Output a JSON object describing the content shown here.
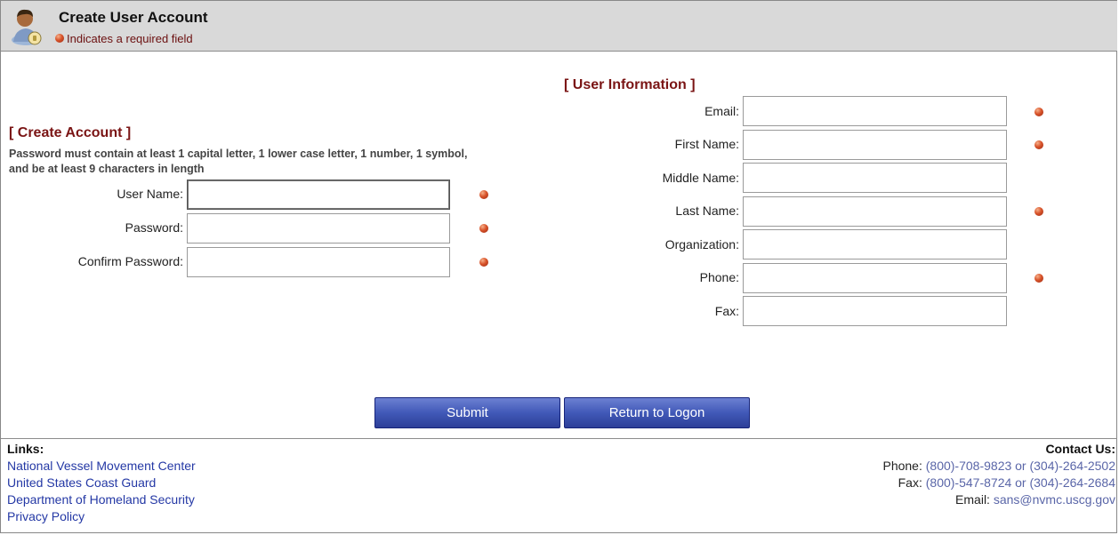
{
  "header": {
    "title": "Create User Account",
    "required_note": "Indicates a required field"
  },
  "create_account": {
    "section_title": "[ Create Account ]",
    "password_note": "Password must contain at least 1 capital letter, 1 lower case letter, 1 number, 1 symbol, and be at least 9 characters in length",
    "fields": [
      {
        "label": "User Name:",
        "value": "",
        "required": true
      },
      {
        "label": "Password:",
        "value": "",
        "required": true
      },
      {
        "label": "Confirm Password:",
        "value": "",
        "required": true
      }
    ]
  },
  "user_information": {
    "section_title": "[ User Information ]",
    "fields": [
      {
        "label": "Email:",
        "value": "",
        "required": true
      },
      {
        "label": "First Name:",
        "value": "",
        "required": true
      },
      {
        "label": "Middle Name:",
        "value": "",
        "required": false
      },
      {
        "label": "Last Name:",
        "value": "",
        "required": true
      },
      {
        "label": "Organization:",
        "value": "",
        "required": false
      },
      {
        "label": "Phone:",
        "value": "",
        "required": true
      },
      {
        "label": "Fax:",
        "value": "",
        "required": false
      }
    ]
  },
  "buttons": {
    "submit": "Submit",
    "return": "Return to Logon"
  },
  "footer": {
    "links_title": "Links:",
    "links": [
      "National Vessel Movement Center",
      "United States Coast Guard",
      "Department of Homeland Security",
      "Privacy Policy"
    ],
    "contact_title": "Contact Us:",
    "phone_label": "Phone:",
    "phone_value": "(800)-708-9823 or (304)-264-2502",
    "fax_label": "Fax:",
    "fax_value": "(800)-547-8724 or (304)-264-2684",
    "email_label": "Email:",
    "email_value": "sans@nvmc.uscg.gov"
  },
  "colors": {
    "header_bg": "#d9d9d9",
    "section_title": "#7a1414",
    "button_blue": "#4159b8",
    "link_blue": "#2438a5",
    "required_dot": "#d8532a"
  },
  "icons": [
    "user-account-icon",
    "required-dot-icon"
  ]
}
